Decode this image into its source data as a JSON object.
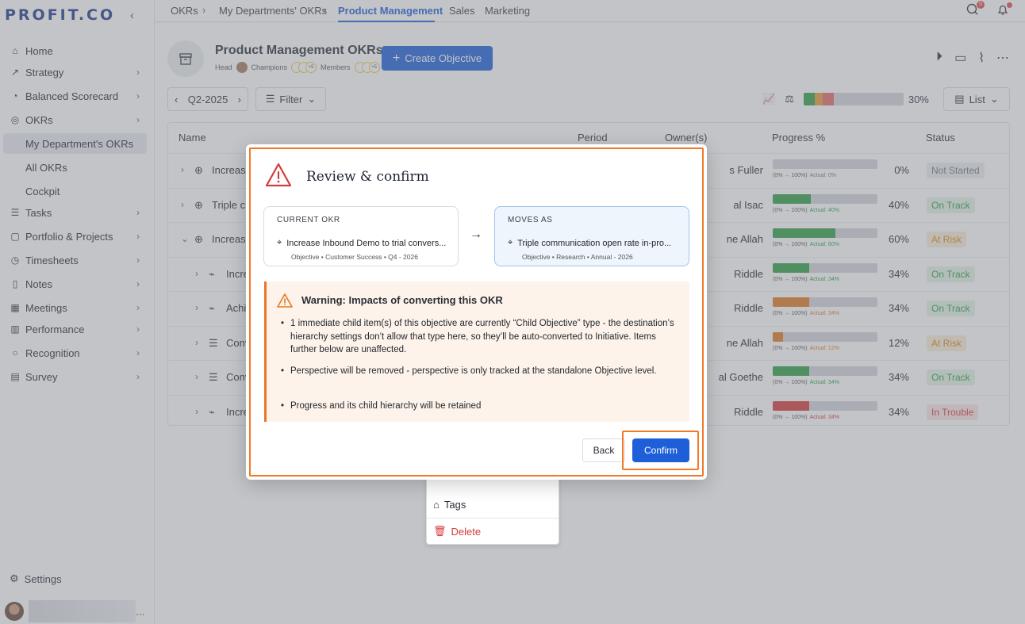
{
  "app": {
    "logo": "PROFIT.CO"
  },
  "sidebar": {
    "items": [
      {
        "label": "Home",
        "icon": "home-icon",
        "chevron": false
      },
      {
        "label": "Strategy",
        "icon": "trend-icon",
        "chevron": true
      },
      {
        "label": "Balanced Scorecard",
        "icon": "pie-icon",
        "chevron": true
      },
      {
        "label": "OKRs",
        "icon": "target-icon",
        "chevron": true
      },
      {
        "label": "Tasks",
        "icon": "list-icon",
        "chevron": true
      },
      {
        "label": "Portfolio & Projects",
        "icon": "folder-icon",
        "chevron": true
      },
      {
        "label": "Timesheets",
        "icon": "clock-icon",
        "chevron": true
      },
      {
        "label": "Notes",
        "icon": "note-icon",
        "chevron": true
      },
      {
        "label": "Meetings",
        "icon": "calendar-icon",
        "chevron": true
      },
      {
        "label": "Performance",
        "icon": "chart-icon",
        "chevron": true
      },
      {
        "label": "Recognition",
        "icon": "circle-icon",
        "chevron": true
      },
      {
        "label": "Survey",
        "icon": "clipboard-icon",
        "chevron": true
      }
    ],
    "okr_sub": [
      "My Department's OKRs",
      "All OKRs",
      "Cockpit"
    ],
    "settings": "Settings",
    "user_more": "..."
  },
  "breadcrumb": [
    "OKRs",
    "My Departments' OKRs",
    "Product Management",
    "Sales",
    "Marketing"
  ],
  "notif_badge": "5",
  "page": {
    "title": "Product Management OKRs",
    "head_label": "Head",
    "champions_label": "Champions",
    "members_label": "Members",
    "more_count": "+5",
    "create_button": "Create Objective",
    "period": "Q2-2025",
    "filter": "Filter",
    "overall_progress": "30%",
    "view": "List"
  },
  "table": {
    "columns": [
      "Name",
      "Period",
      "Owner(s)",
      "Progress %",
      "Status"
    ],
    "rows": [
      {
        "name": "Increas",
        "owner": "s Fuller",
        "pct": "0%",
        "fill": 0,
        "color": "#c9c9c9",
        "range": "(0% → 100%)",
        "actual": "Actual: 0%",
        "actual_color": "#777",
        "status": "Not Started",
        "st_bg": "#eceef1",
        "st_fg": "#777",
        "level": 0,
        "icon": "target"
      },
      {
        "name": "Triple c",
        "owner": "al Isac",
        "pct": "40%",
        "fill": 0.36,
        "color": "#2f9e44",
        "range": "(0% → 100%)",
        "actual": "Actual: 40%",
        "actual_color": "#2f9e44",
        "status": "On Track",
        "st_bg": "#e3f4e6",
        "st_fg": "#2f9e44",
        "level": 0,
        "icon": "target"
      },
      {
        "name": "Increas",
        "owner": "ne Allah",
        "pct": "60%",
        "fill": 0.6,
        "color": "#2f9e44",
        "range": "(0% → 100%)",
        "actual": "Actual: 60%",
        "actual_color": "#2f9e44",
        "status": "At Risk",
        "st_bg": "#fbeed8",
        "st_fg": "#d88a1a",
        "level": 0,
        "icon": "target",
        "expanded": true
      },
      {
        "name": "Incre",
        "owner": "Riddle",
        "pct": "34%",
        "fill": 0.35,
        "color": "#2f9e44",
        "range": "(0% → 100%)",
        "actual": "Actual: 34%",
        "actual_color": "#2f9e44",
        "status": "On Track",
        "st_bg": "#e3f4e6",
        "st_fg": "#2f9e44",
        "level": 1,
        "icon": "tag"
      },
      {
        "name": "Achi",
        "owner": "Riddle",
        "pct": "34%",
        "fill": 0.35,
        "color": "#e07a1f",
        "range": "(0% → 100%)",
        "actual": "Actual: 34%",
        "actual_color": "#e07a1f",
        "status": "On Track",
        "st_bg": "#e3f4e6",
        "st_fg": "#2f9e44",
        "level": 1,
        "icon": "tag"
      },
      {
        "name": "Conv",
        "owner": "ne Allah",
        "pct": "12%",
        "fill": 0.1,
        "color": "#e07a1f",
        "range": "(0% → 100%)",
        "actual": "Actual: 12%",
        "actual_color": "#e07a1f",
        "status": "At Risk",
        "st_bg": "#fbeed8",
        "st_fg": "#d88a1a",
        "level": 1,
        "icon": "doc"
      },
      {
        "name": "Conv",
        "owner": "al Goethe",
        "pct": "34%",
        "fill": 0.35,
        "color": "#2f9e44",
        "range": "(0% → 100%)",
        "actual": "Actual: 34%",
        "actual_color": "#2f9e44",
        "status": "On Track",
        "st_bg": "#e3f4e6",
        "st_fg": "#2f9e44",
        "level": 1,
        "icon": "doc"
      },
      {
        "name": "Incre",
        "owner": "Riddle",
        "pct": "34%",
        "fill": 0.35,
        "color": "#d63b3b",
        "range": "(0% → 100%)",
        "actual": "Actual: 34%",
        "actual_color": "#d63b3b",
        "status": "In Trouble",
        "st_bg": "#fbe3e3",
        "st_fg": "#d63b3b",
        "level": 1,
        "icon": "tag"
      }
    ]
  },
  "context_menu": {
    "tags": "Tags",
    "delete": "Delete"
  },
  "modal": {
    "title": "Review & confirm",
    "current_label": "CURRENT OKR",
    "current_name": "Increase Inbound Demo to trial convers...",
    "current_meta": "Objective  •  Customer Success  •  Q4 - 2026",
    "moves_label": "MOVES AS",
    "moves_name": "Triple communication open rate in-pro...",
    "moves_meta": "Objective  •  Research  •  Annual - 2026",
    "warning_title": "Warning: Impacts of converting this OKR",
    "bullets": [
      "1 immediate child item(s) of this objective are currently “Child Objective” type - the destination’s hierarchy settings don’t allow that type here, so they’ll be auto-converted to Initiative. Items further below are unaffected.",
      "Perspective will be removed - perspective is only tracked at the standalone Objective level.",
      "Progress and its child hierarchy will be retained"
    ],
    "back": "Back",
    "confirm": "Confirm"
  },
  "colors": {
    "accent": "#1e5fd9",
    "highlight": "#f07a28"
  }
}
